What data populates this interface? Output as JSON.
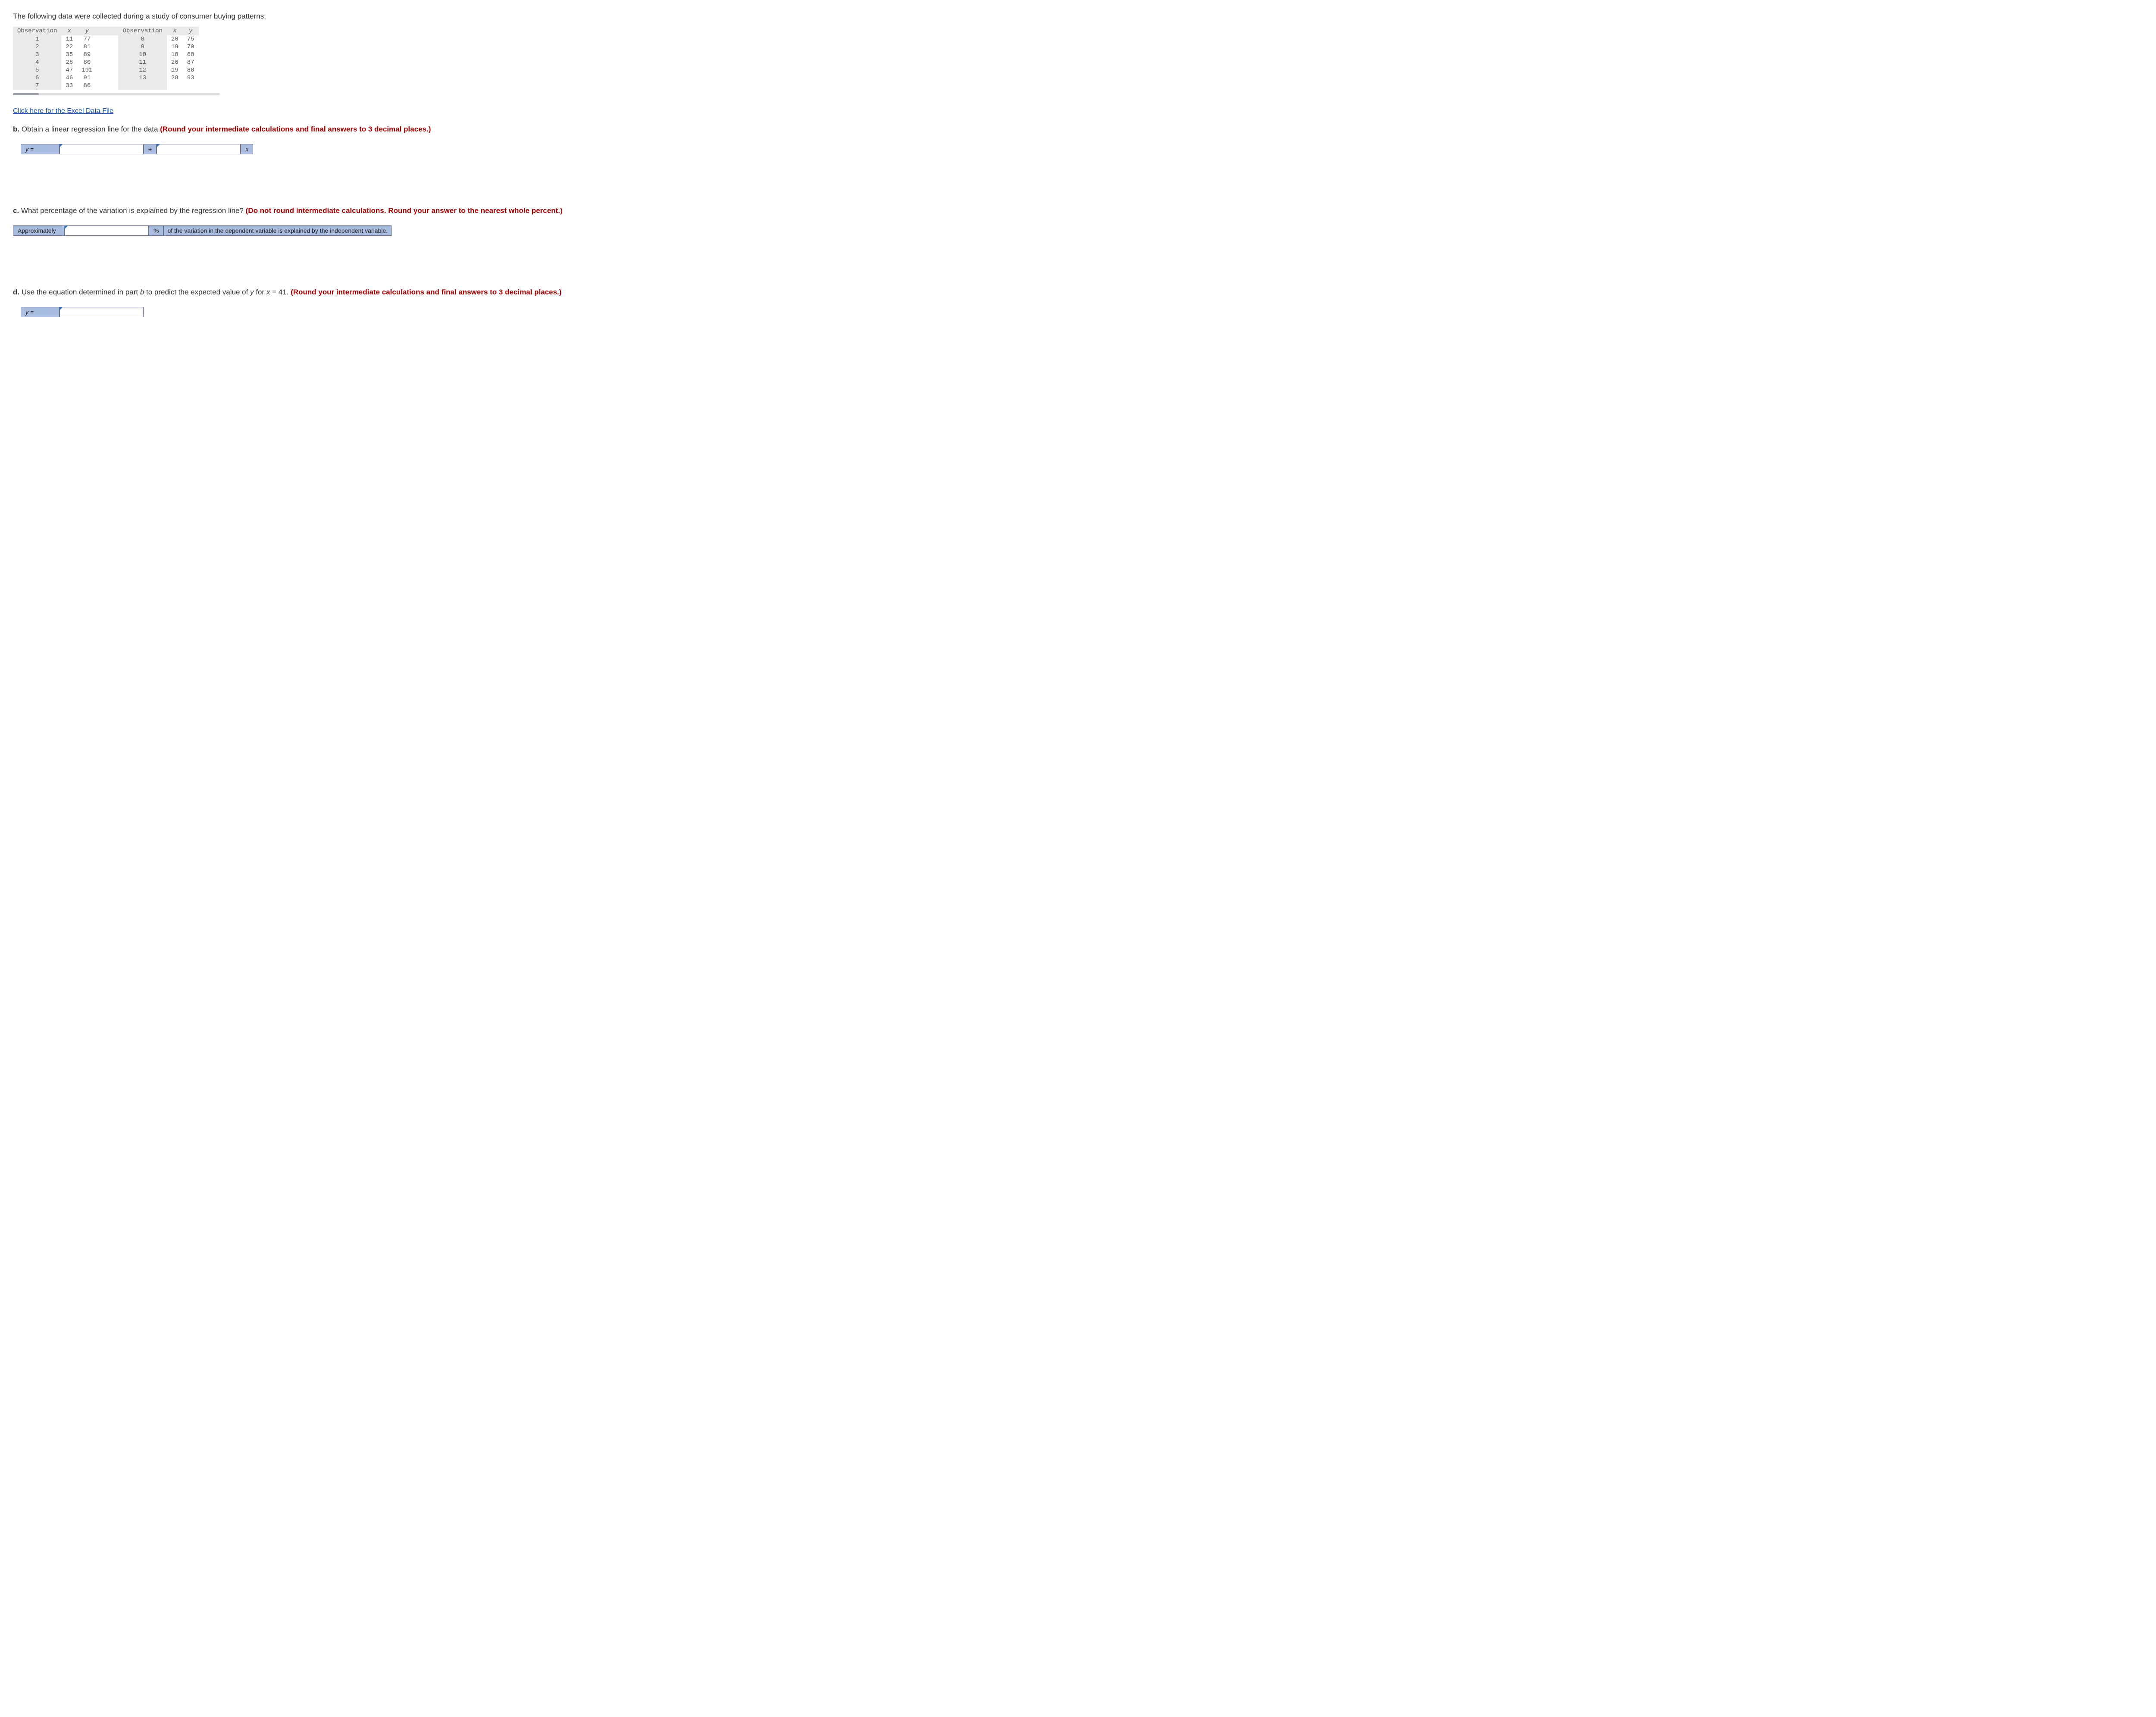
{
  "intro": "The following data were collected during a study of consumer buying patterns:",
  "table": {
    "headers_left": [
      "Observation",
      "x",
      "y"
    ],
    "headers_right": [
      "Observation",
      "x",
      "y"
    ],
    "rows_left": [
      {
        "obs": "1",
        "x": "11",
        "y": "77"
      },
      {
        "obs": "2",
        "x": "22",
        "y": "81"
      },
      {
        "obs": "3",
        "x": "35",
        "y": "89"
      },
      {
        "obs": "4",
        "x": "28",
        "y": "80"
      },
      {
        "obs": "5",
        "x": "47",
        "y": "101"
      },
      {
        "obs": "6",
        "x": "46",
        "y": "91"
      },
      {
        "obs": "7",
        "x": "33",
        "y": "86"
      }
    ],
    "rows_right": [
      {
        "obs": "8",
        "x": "20",
        "y": "75"
      },
      {
        "obs": "9",
        "x": "19",
        "y": "70"
      },
      {
        "obs": "10",
        "x": "18",
        "y": "68"
      },
      {
        "obs": "11",
        "x": "26",
        "y": "87"
      },
      {
        "obs": "12",
        "x": "19",
        "y": "88"
      },
      {
        "obs": "13",
        "x": "28",
        "y": "93"
      }
    ]
  },
  "excel_link": "Click here for the Excel Data File",
  "part_b": {
    "label": "b.",
    "text": " Obtain a linear regression line for the data.",
    "bold_text": "(Round your intermediate calculations and final answers to 3 decimal places.)",
    "y_label": "y =",
    "plus": "+",
    "x_label": "x",
    "input1": "",
    "input2": ""
  },
  "part_c": {
    "label": "c.",
    "text": " What percentage of the variation is explained by the regression line? ",
    "bold_text": "(Do not round intermediate calculations. Round your answer to the nearest whole percent.)",
    "approx_label": "Approximately",
    "percent": "%",
    "trail": "of the variation in the dependent variable is explained by the independent variable.",
    "input": ""
  },
  "part_d": {
    "label": "d.",
    "text_before_italic": " Use the equation determined in part ",
    "italic_b": "b",
    "text_mid": " to predict the expected value of ",
    "italic_y": "y",
    "text_for": " for ",
    "italic_x": "x",
    "text_eq": " = 41. ",
    "bold_text": "(Round your intermediate calculations and final answers to 3 decimal places.)",
    "y_label": "y =",
    "input": ""
  }
}
